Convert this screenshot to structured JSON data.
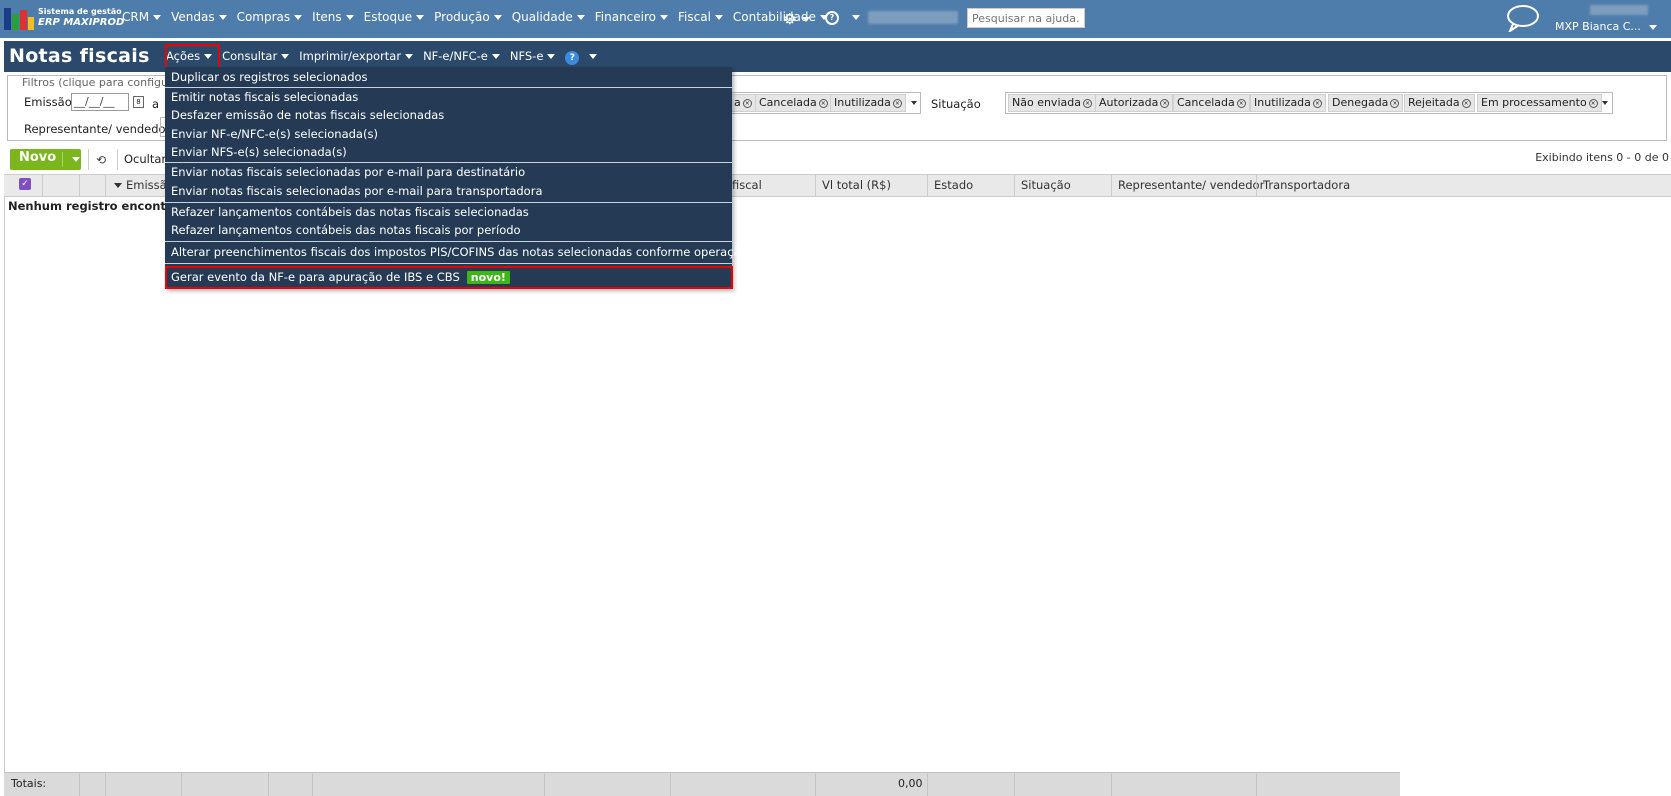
{
  "brand": {
    "line1": "Sistema de gestão",
    "line2": "ERP MAXIPROD"
  },
  "nav": [
    "CRM",
    "Vendas",
    "Compras",
    "Itens",
    "Estoque",
    "Produção",
    "Qualidade",
    "Financeiro",
    "Fiscal",
    "Contabilidade"
  ],
  "search": {
    "placeholder": "Pesquisar na ajuda..."
  },
  "user": {
    "name": "MXP Bianca C..."
  },
  "page": {
    "title": "Notas fiscais"
  },
  "menu": [
    "Ações",
    "Consultar",
    "Imprimir/exportar",
    "NF-e/NFC-e",
    "NFS-e"
  ],
  "filters": {
    "legend": "Filtros (clique para configur",
    "emissao_label": "Emissão",
    "date_placeholder": "__/__/__",
    "a_label": "a",
    "representante_label": "Representante/ vendedor",
    "estado_tags": [
      "a",
      "Cancelada",
      "Inutilizada"
    ],
    "situacao_label": "Situação",
    "situacao_tags": [
      "Não enviada",
      "Autorizada",
      "Cancelada",
      "Inutilizada",
      "Denegada",
      "Rejeitada",
      "Em processamento"
    ]
  },
  "toolbar": {
    "novo": "Novo",
    "ocultar": "Ocultar",
    "exibindo": "Exibindo itens 0 - 0 de 0"
  },
  "table": {
    "columns": [
      "Emissão",
      "fiscal",
      "Vl total (R$)",
      "Estado",
      "Situação",
      "Representante/ vendedor",
      "Transportadora"
    ],
    "empty": "Nenhum registro encontrad"
  },
  "totals": {
    "label": "Totais:",
    "value": "0,00"
  },
  "dropdown": {
    "items": [
      "Duplicar os registros selecionados",
      "Emitir notas fiscais selecionadas",
      "Desfazer emissão de notas fiscais selecionadas",
      "Enviar NF-e/NFC-e(s) selecionada(s)",
      "Enviar NFS-e(s) selecionada(s)",
      "Enviar notas fiscais selecionadas por e-mail para destinatário",
      "Enviar notas fiscais selecionadas por e-mail para transportadora",
      "Refazer lançamentos contábeis das notas fiscais selecionadas",
      "Refazer lançamentos contábeis das notas fiscais por período",
      "Alterar preenchimentos fiscais dos impostos PIS/COFINS das notas selecionadas conforme operação fiscal",
      "Gerar evento da NF-e para apuração de IBS e CBS"
    ],
    "badge": "novo!"
  }
}
